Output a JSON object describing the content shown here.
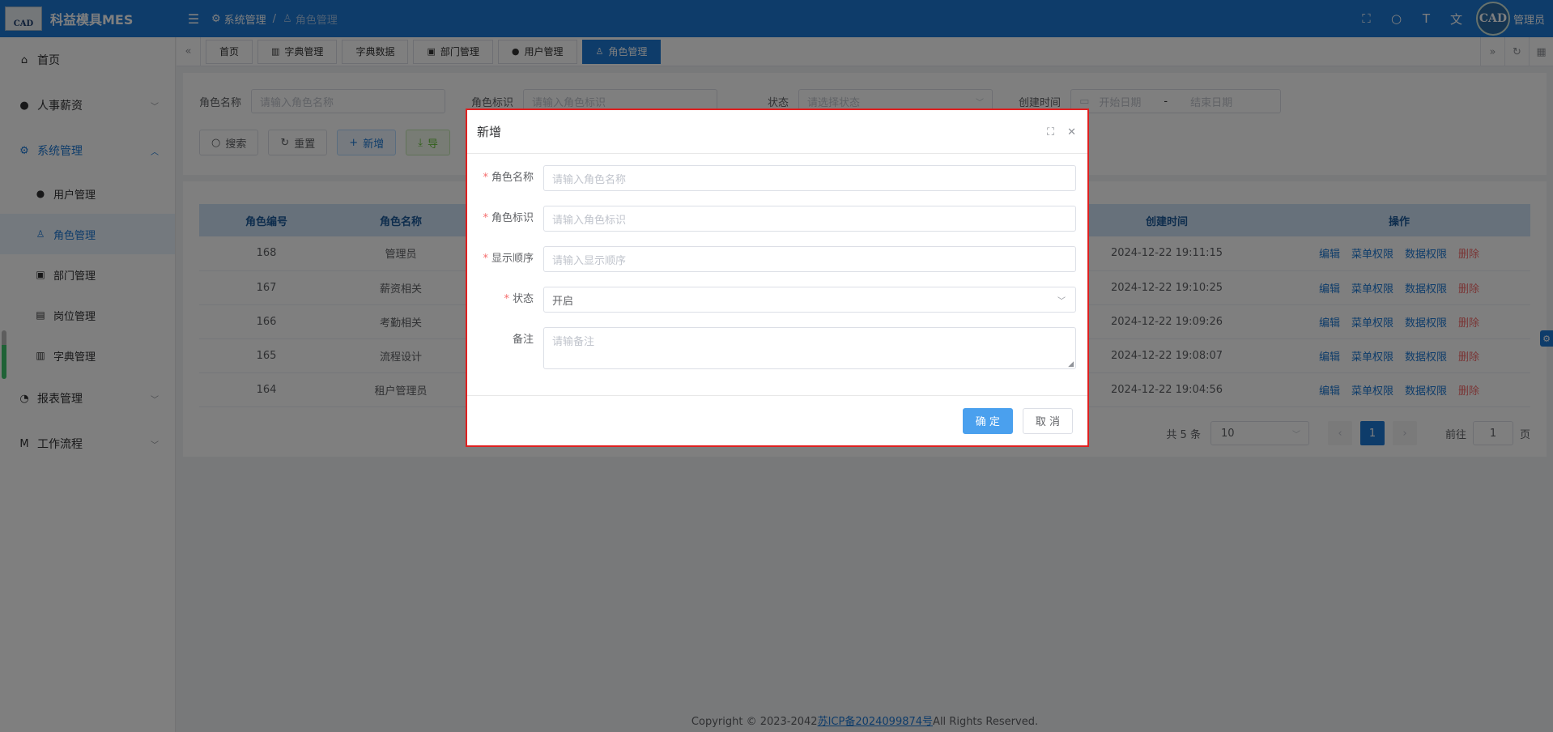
{
  "app": {
    "logo_text": "CAD",
    "title": "科益模具MES"
  },
  "header": {
    "breadcrumb": [
      "系统管理",
      "角色管理"
    ],
    "user_avatar": "CAD",
    "user_name": "管理员"
  },
  "sidebar": {
    "home": "首页",
    "hr": "人事薪资",
    "system": "系统管理",
    "sub": [
      "用户管理",
      "角色管理",
      "部门管理",
      "岗位管理",
      "字典管理"
    ],
    "report": "报表管理",
    "workflow": "工作流程"
  },
  "tabs": [
    "首页",
    "字典管理",
    "字典数据",
    "部门管理",
    "用户管理",
    "角色管理"
  ],
  "search": {
    "role_name_label": "角色名称",
    "role_name_placeholder": "请输入角色名称",
    "role_key_label": "角色标识",
    "role_key_placeholder": "请输入角色标识",
    "status_label": "状态",
    "status_placeholder": "请选择状态",
    "created_label": "创建时间",
    "start_date": "开始日期",
    "date_sep": "-",
    "end_date": "结束日期",
    "btn_search": "搜索",
    "btn_reset": "重置",
    "btn_add": "新增",
    "btn_export": "导"
  },
  "table": {
    "columns": [
      "角色编号",
      "角色名称",
      "",
      "",
      "",
      "",
      "创建时间",
      "操作"
    ],
    "rows": [
      {
        "id": "168",
        "name": "管理员",
        "time": "2024-12-22 19:11:15"
      },
      {
        "id": "167",
        "name": "薪资相关",
        "time": "2024-12-22 19:10:25"
      },
      {
        "id": "166",
        "name": "考勤相关",
        "time": "2024-12-22 19:09:26"
      },
      {
        "id": "165",
        "name": "流程设计",
        "time": "2024-12-22 19:08:07"
      },
      {
        "id": "164",
        "name": "租户管理员",
        "time": "2024-12-22 19:04:56"
      }
    ],
    "actions": {
      "edit": "编辑",
      "menu": "菜单权限",
      "data": "数据权限",
      "delete": "删除"
    }
  },
  "pager": {
    "total": "共 5 条",
    "page_size": "10",
    "current": "1",
    "goto_label": "前往",
    "goto_value": "1",
    "page_unit": "页"
  },
  "footer": {
    "prefix": "Copyright © 2023-2042",
    "icp": "苏ICP备2024099874号",
    "suffix": "All Rights Reserved."
  },
  "dialog": {
    "title": "新增",
    "name_label": "角色名称",
    "name_placeholder": "请输入角色名称",
    "key_label": "角色标识",
    "key_placeholder": "请输入角色标识",
    "order_label": "显示顺序",
    "order_placeholder": "请输入显示顺序",
    "status_label": "状态",
    "status_value": "开启",
    "remark_label": "备注",
    "remark_placeholder": "请输备注",
    "ok": "确 定",
    "cancel": "取 消"
  },
  "colors": {
    "brand": "#1c78d5",
    "danger": "#f56c6c",
    "dialog_border": "#e02020"
  }
}
